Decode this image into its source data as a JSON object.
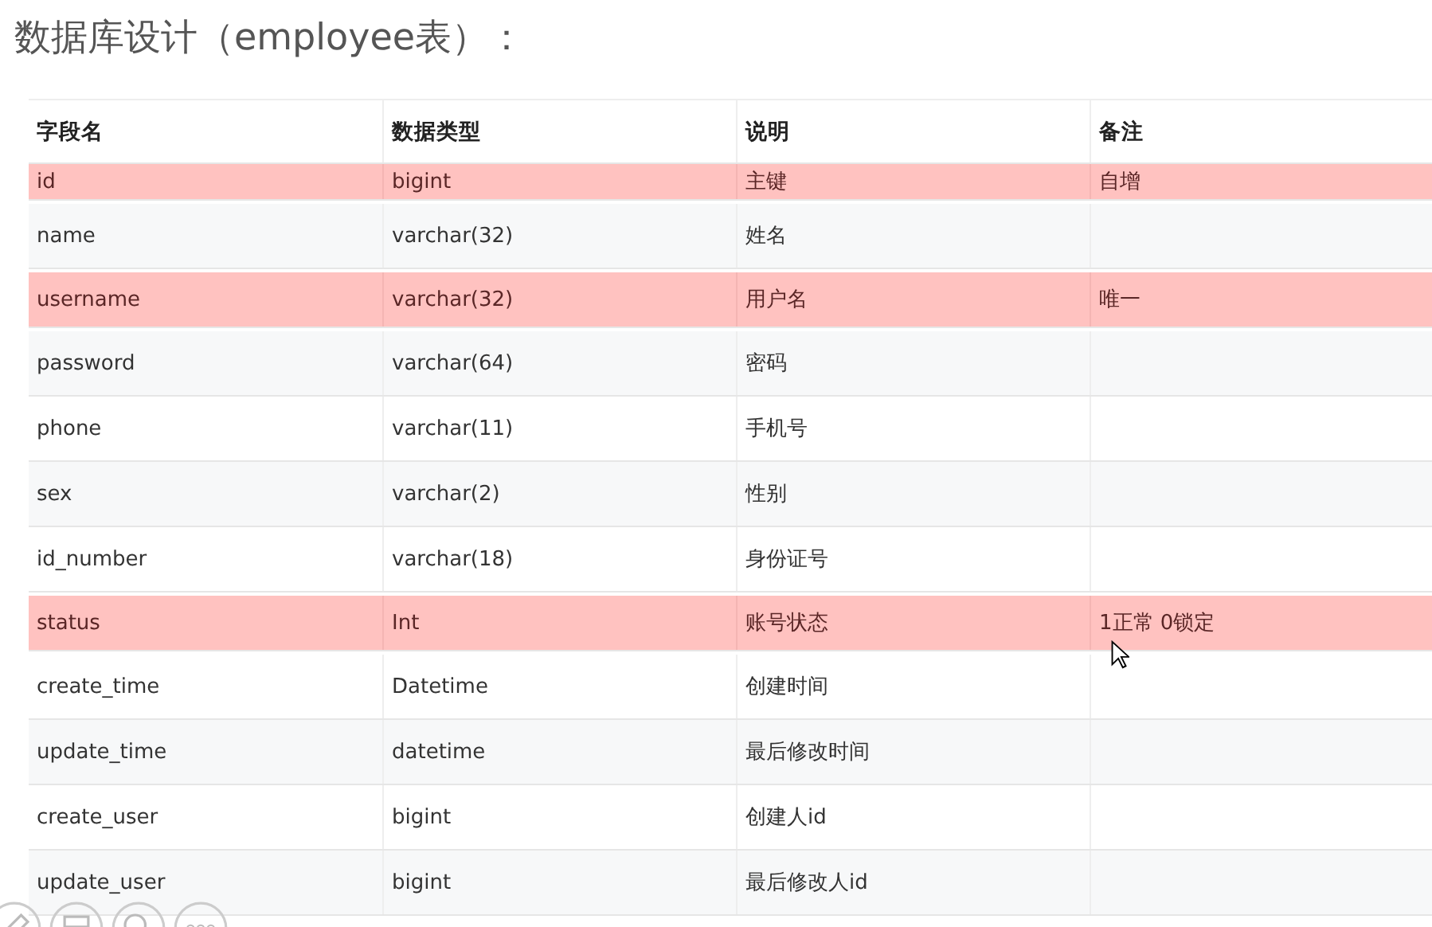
{
  "title": "数据库设计（employee表）：",
  "table": {
    "columns": [
      "字段名",
      "数据类型",
      "说明",
      "备注"
    ],
    "rows": [
      {
        "cells": [
          "id",
          "bigint",
          "主键",
          "自增"
        ],
        "highlighted": true
      },
      {
        "cells": [
          "name",
          "varchar(32)",
          "姓名",
          ""
        ],
        "highlighted": false
      },
      {
        "cells": [
          "username",
          "varchar(32)",
          "用户名",
          "唯一"
        ],
        "highlighted": true
      },
      {
        "cells": [
          "password",
          "varchar(64)",
          "密码",
          ""
        ],
        "highlighted": false
      },
      {
        "cells": [
          "phone",
          "varchar(11)",
          "手机号",
          ""
        ],
        "highlighted": false
      },
      {
        "cells": [
          "sex",
          "varchar(2)",
          "性别",
          ""
        ],
        "highlighted": false
      },
      {
        "cells": [
          "id_number",
          "varchar(18)",
          "身份证号",
          ""
        ],
        "highlighted": false
      },
      {
        "cells": [
          "status",
          "Int",
          "账号状态",
          "1正常 0锁定"
        ],
        "highlighted": true
      },
      {
        "cells": [
          "create_time",
          "Datetime",
          "创建时间",
          ""
        ],
        "highlighted": false
      },
      {
        "cells": [
          "update_time",
          "datetime",
          "最后修改时间",
          ""
        ],
        "highlighted": false
      },
      {
        "cells": [
          "create_user",
          "bigint",
          "创建人id",
          ""
        ],
        "highlighted": false
      },
      {
        "cells": [
          "update_user",
          "bigint",
          "最后修改人id",
          ""
        ],
        "highlighted": false
      }
    ]
  }
}
